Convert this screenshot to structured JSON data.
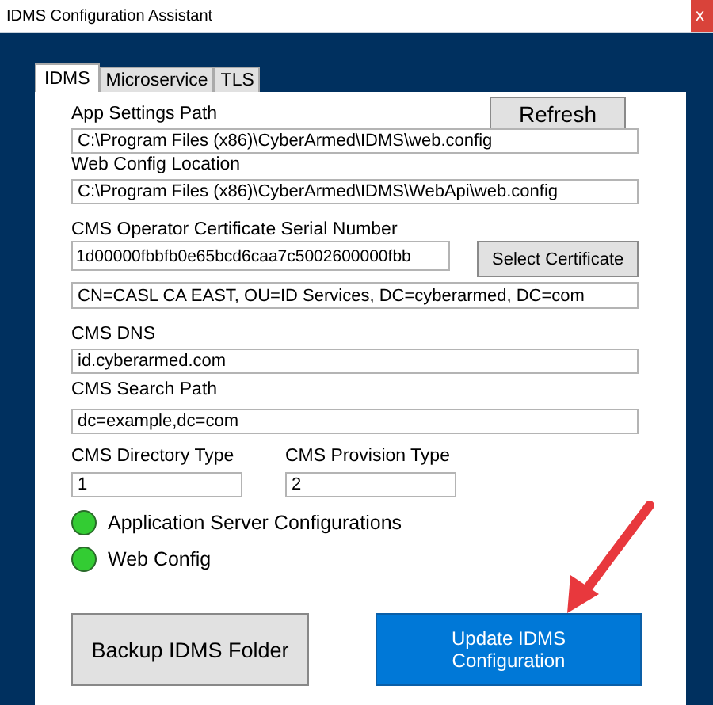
{
  "window": {
    "title": "IDMS Configuration Assistant",
    "close": "x"
  },
  "tabs": [
    {
      "label": "IDMS",
      "selected": true
    },
    {
      "label": "Microservice",
      "selected": false
    },
    {
      "label": "TLS",
      "selected": false
    }
  ],
  "refresh_button": "Refresh",
  "app_settings_path": {
    "label": "App Settings Path",
    "value": "C:\\Program Files (x86)\\CyberArmed\\IDMS\\web.config"
  },
  "web_config_location": {
    "label": "Web Config Location",
    "value": "C:\\Program Files (x86)\\CyberArmed\\IDMS\\WebApi\\web.config"
  },
  "certificate_serial": {
    "label": "CMS Operator Certificate Serial Number",
    "value": "1d00000fbbfb0e65bcd6caa7c5002600000fbb"
  },
  "select_certificate_button": "Select Certificate",
  "certificate_subject": {
    "value": "CN=CASL CA EAST, OU=ID Services, DC=cyberarmed, DC=com"
  },
  "cms_dns": {
    "label": "CMS DNS",
    "value": "id.cyberarmed.com"
  },
  "cms_search_path": {
    "label": "CMS Search Path",
    "value": "dc=example,dc=com"
  },
  "cms_directory_type": {
    "label": "CMS Directory Type",
    "value": "1"
  },
  "cms_provision_type": {
    "label": "CMS Provision Type",
    "value": "2"
  },
  "status_items": [
    {
      "label": "Application Server Configurations",
      "color": "#33cc33"
    },
    {
      "label": "Web Config",
      "color": "#33cc33"
    }
  ],
  "buttons": [
    {
      "label": "Backup IDMS Folder",
      "kind": "plain"
    },
    {
      "label": "Update IDMS Configuration",
      "kind": "primary"
    }
  ]
}
